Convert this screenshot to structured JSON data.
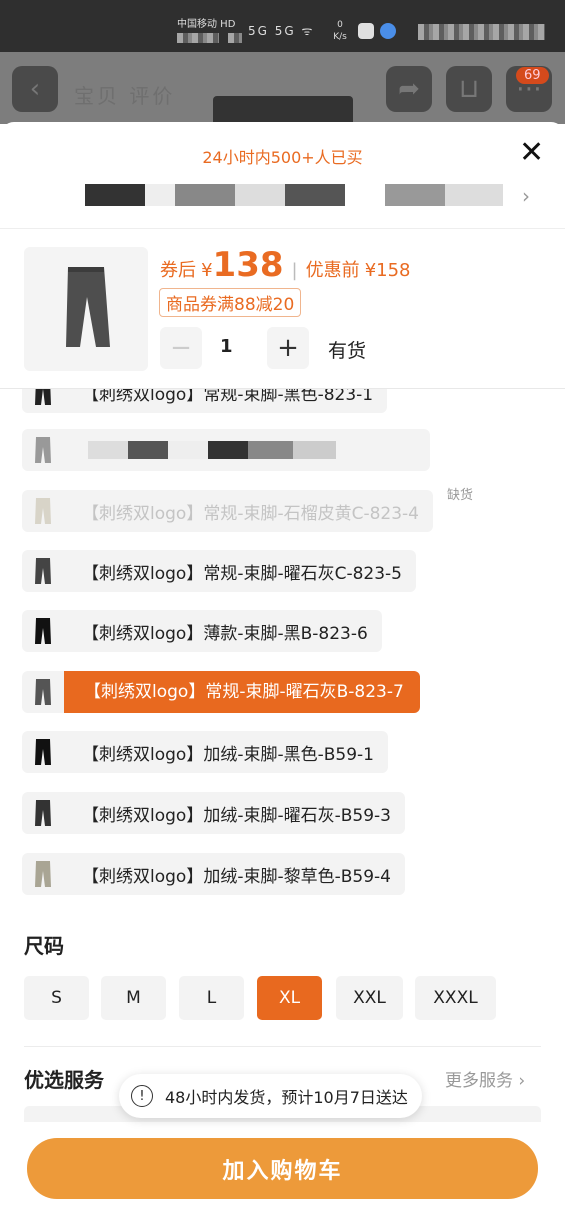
{
  "status_bar": {
    "carrier": "中国移动 HD",
    "signal_text": "5G 5G ᯤ",
    "speed": "0 K/s"
  },
  "header": {
    "title": "宝贝 评价",
    "back_icon": "back-icon",
    "share_icon": "share-icon",
    "cart_icon": "cart-icon",
    "message_badge": "69"
  },
  "sheet": {
    "sold_text": "24小时内500+人已买",
    "close_label": "✕",
    "price": {
      "after_coupon_label": "券后",
      "currency": "¥",
      "after_coupon_value": "138",
      "separator": "|",
      "before_label": "优惠前",
      "before_value": "¥158"
    },
    "coupon": "商品券满88减20",
    "quantity": {
      "minus": "−",
      "value": "1",
      "plus": "+"
    },
    "stock_status": "有货"
  },
  "variants": [
    {
      "label": "【刺绣双logo】常规-束脚-黑色-823-1",
      "state": "normal"
    },
    {
      "label": "",
      "state": "normal"
    },
    {
      "label": "【刺绣双logo】常规-束脚-石榴皮黄C-823-4",
      "state": "disabled",
      "tag": "缺货"
    },
    {
      "label": "【刺绣双logo】常规-束脚-曜石灰C-823-5",
      "state": "normal"
    },
    {
      "label": "【刺绣双logo】薄款-束脚-黑B-823-6",
      "state": "normal"
    },
    {
      "label": "【刺绣双logo】常规-束脚-曜石灰B-823-7",
      "state": "selected"
    },
    {
      "label": "【刺绣双logo】加绒-束脚-黑色-B59-1",
      "state": "normal"
    },
    {
      "label": "【刺绣双logo】加绒-束脚-曜石灰-B59-3",
      "state": "normal"
    },
    {
      "label": "【刺绣双logo】加绒-束脚-黎草色-B59-4",
      "state": "normal"
    }
  ],
  "size": {
    "title": "尺码",
    "options": [
      "S",
      "M",
      "L",
      "XL",
      "XXL",
      "XXXL"
    ],
    "selected": "XL"
  },
  "services": {
    "title": "优选服务",
    "more": "更多服务 ›"
  },
  "toast": {
    "icon": "!",
    "text": "48小时内发货，预计10月7日送达"
  },
  "cart_button": "加入购物车",
  "colors": {
    "accent": "#e8691f",
    "cart_button": "#ed9a3a",
    "price": "#e96b22"
  }
}
